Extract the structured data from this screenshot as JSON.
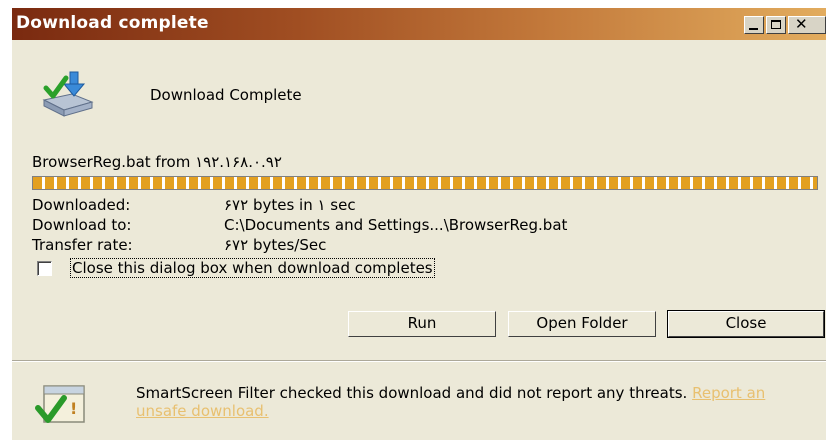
{
  "window": {
    "title": "Download complete",
    "controls": [
      "minimize",
      "maximize",
      "close"
    ]
  },
  "header": {
    "icon": "download-complete-icon",
    "heading": "Download Complete"
  },
  "download": {
    "source_text": "BrowserReg.bat from ۱۹۲.۱۶۸.۰.۹۲",
    "progress": 1.0,
    "fields": {
      "downloaded_label": "Downloaded:",
      "downloaded_value": "۶۷۲ bytes in ۱ sec",
      "download_to_label": "Download to:",
      "download_to_value": "C:\\Documents and Settings...\\BrowserReg.bat",
      "transfer_rate_label": "Transfer rate:",
      "transfer_rate_value": "۶۷۲ bytes/Sec"
    }
  },
  "options": {
    "close_on_complete_label": "Close this dialog box when download completes",
    "close_on_complete_checked": false
  },
  "buttons": {
    "run": "Run",
    "open_folder": "Open Folder",
    "close": "Close"
  },
  "smartscreen": {
    "icon": "shield-check-icon",
    "message": "SmartScreen Filter checked this download and did not report any threats.",
    "link": "Report an unsafe download."
  },
  "colors": {
    "title_bar_start": "#7a2a10",
    "title_bar_end": "#e2ac5e",
    "progress_fill": "#e3a020",
    "link": "#e8c070",
    "dialog_bg": "#ece9d8"
  }
}
